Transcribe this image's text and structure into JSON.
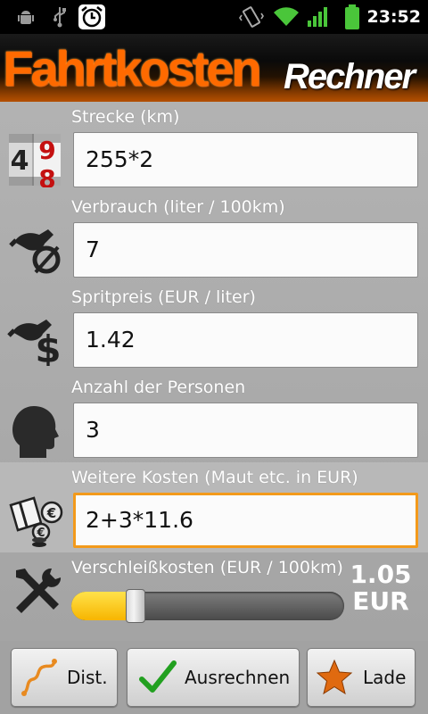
{
  "status_bar": {
    "time": "23:52",
    "icons": [
      "android-debug-icon",
      "usb-icon",
      "alarm-icon",
      "vibrate-icon",
      "wifi-icon",
      "signal-icon",
      "battery-icon"
    ]
  },
  "banner": {
    "title_main": "Fahrtkosten",
    "title_sub": "Rechner"
  },
  "fields": [
    {
      "label": "Strecke (km)",
      "value": "255*2",
      "icon": "odometer-icon"
    },
    {
      "label": "Verbrauch (liter / 100km)",
      "value": "7",
      "icon": "fuel-consumption-icon"
    },
    {
      "label": "Spritpreis (EUR / liter)",
      "value": "1.42",
      "icon": "fuel-price-icon"
    },
    {
      "label": "Anzahl der Personen",
      "value": "3",
      "icon": "person-head-icon"
    },
    {
      "label": "Weitere Kosten (Maut etc. in EUR)",
      "value": "2+3*11.6",
      "icon": "extra-costs-icon"
    }
  ],
  "wear": {
    "label": "Verschleißkosten (EUR / 100km)",
    "value": "1.05",
    "unit": "EUR",
    "slider_fraction": 0.235,
    "icon": "tools-icon"
  },
  "buttons": {
    "dist": "Dist.",
    "calculate": "Ausrechnen",
    "load": "Lade"
  },
  "colors": {
    "accent_orange": "#f39a1b",
    "slider_yellow": "#f7b500",
    "check_green": "#22a020",
    "star_orange": "#e06a10"
  }
}
